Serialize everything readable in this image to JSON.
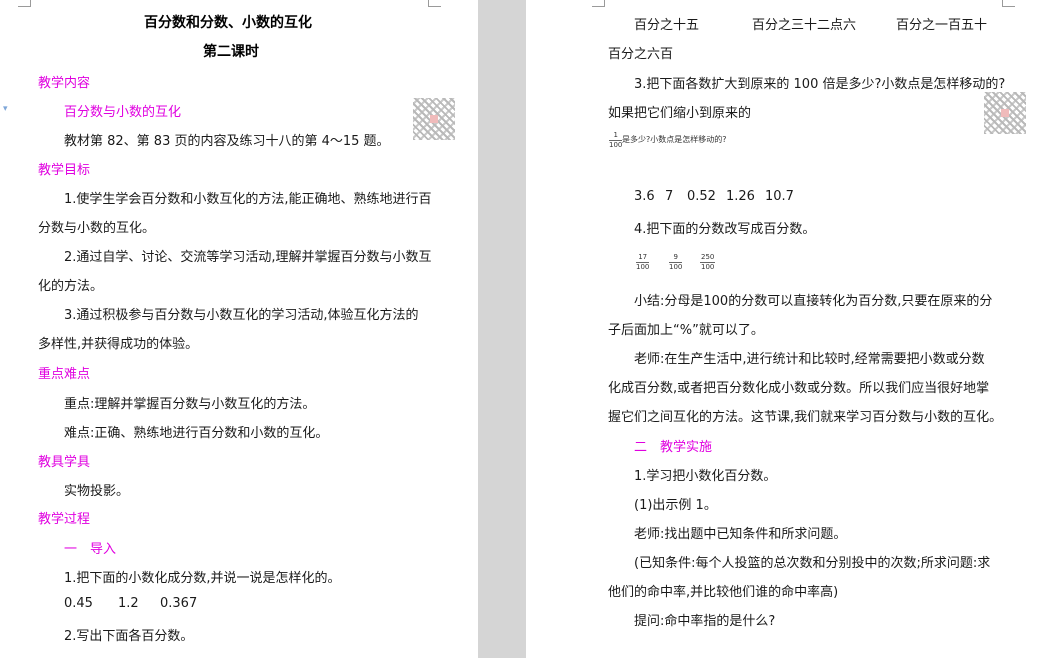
{
  "left_page": {
    "title": "百分数和分数、小数的互化",
    "subtitle": "第二课时",
    "sections": [
      {
        "heading": "教学内容"
      },
      {
        "heading": "教学目标"
      },
      {
        "heading": "重点难点"
      },
      {
        "heading": "教具学具"
      },
      {
        "heading": "教学过程"
      }
    ],
    "content_topic": "百分数与小数的互化",
    "content_text": "教材第 82、第 83 页的内容及练习十八的第 4～15 题。",
    "goal_1a": "1.使学生学会百分数和小数互化的方法,能正确地、熟练地进行百",
    "goal_1b": "分数与小数的互化。",
    "goal_2a": "2.通过自学、讨论、交流等学习活动,理解并掌握百分数与小数互",
    "goal_2b": "化的方法。",
    "goal_3a": "3.通过积极参与百分数与小数互化的学习活动,体验互化方法的",
    "goal_3b": "多样性,并获得成功的体验。",
    "key_point": "重点:理解并掌握百分数与小数互化的方法。",
    "difficult_point": "难点:正确、熟练地进行百分数和小数的互化。",
    "tools": "实物投影。",
    "intro_heading": "一　导入",
    "task_1": "1.把下面的小数化成分数,并说一说是怎样化的。",
    "decimals": [
      "0.45",
      "1.2",
      "0.367"
    ],
    "task_2": "2.写出下面各百分数。"
  },
  "right_page": {
    "percent_words": [
      "百分之十五",
      "百分之三十二点六",
      "百分之一百五十"
    ],
    "percent_words_2": "百分之六百",
    "task_3a": "3.把下面各数扩大到原来的 100 倍是多少?小数点是怎样移动的?",
    "task_3b": "如果把它们缩小到原来的",
    "task_3_frac": {
      "num": "1",
      "den": "100"
    },
    "task_3c": "是多少?小数点是怎样移动的?",
    "numbers": [
      "3.6",
      "7",
      "0.52",
      "1.26",
      "10.7"
    ],
    "task_4": "4.把下面的分数改写成百分数。",
    "fractions": [
      {
        "num": "17",
        "den": "100"
      },
      {
        "num": "9",
        "den": "100"
      },
      {
        "num": "250",
        "den": "100"
      }
    ],
    "summary_a": "小结:分母是100的分数可以直接转化为百分数,只要在原来的分",
    "summary_b": "子后面加上“%”就可以了。",
    "teacher_1a": "老师:在生产生活中,进行统计和比较时,经常需要把小数或分数",
    "teacher_1b": "化成百分数,或者把百分数化成小数或分数。所以我们应当很好地掌",
    "teacher_1c": "握它们之间互化的方法。这节课,我们就来学习百分数与小数的互化。",
    "implement_heading": "二　教学实施",
    "step_1": "1.学习把小数化百分数。",
    "step_1_1": "(1)出示例 1。",
    "teacher_2": "老师:找出题中已知条件和所求问题。",
    "condition_a": "(已知条件:每个人投篮的总次数和分别投中的次数;所求问题:求",
    "condition_b": "他们的命中率,并比较他们谁的命中率高)",
    "question": "提问:命中率指的是什么?"
  },
  "colors": {
    "heading": "#e000e0",
    "text": "#1a1a1a",
    "background": "#d5d5d5",
    "page": "#ffffff"
  }
}
